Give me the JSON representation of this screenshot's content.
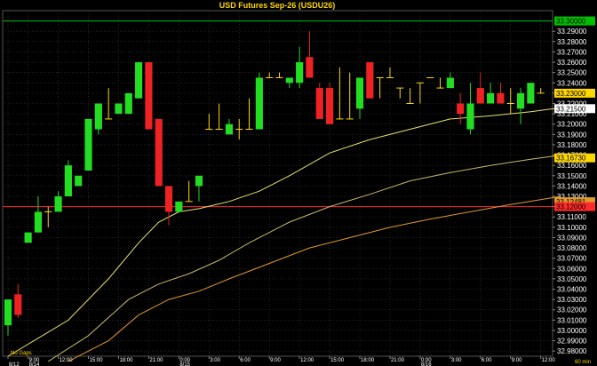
{
  "chart_data": {
    "type": "candlestick",
    "title": "USD  Futures  Sep-26  (USDU26)",
    "timeframe": "60  min",
    "note": "No  Gaps",
    "ylim": [
      32.975,
      33.31
    ],
    "y_ticks": [
      "33.29000",
      "33.28000",
      "33.27000",
      "33.26000",
      "33.25000",
      "33.24000",
      "33.23000",
      "33.22000",
      "33.21000",
      "33.20000",
      "33.19000",
      "33.18000",
      "33.17000",
      "33.16000",
      "33.15000",
      "33.14000",
      "33.13000",
      "33.12000",
      "33.11000",
      "33.10000",
      "33.09000",
      "33.08000",
      "33.07000",
      "33.06000",
      "33.05000",
      "33.04000",
      "33.03000",
      "33.02000",
      "33.01000",
      "33.00000",
      "32.99000",
      "32.98000"
    ],
    "y_tick_values": [
      33.29,
      33.28,
      33.27,
      33.26,
      33.25,
      33.24,
      33.23,
      33.22,
      33.21,
      33.2,
      33.19,
      33.18,
      33.17,
      33.16,
      33.15,
      33.14,
      33.13,
      33.12,
      33.11,
      33.1,
      33.09,
      33.08,
      33.07,
      33.06,
      33.05,
      33.04,
      33.03,
      33.02,
      33.01,
      33.0,
      32.99,
      32.98
    ],
    "x_ticks": [
      {
        "bar": 0,
        "top": "",
        "bottom": "8/12"
      },
      {
        "bar": 2,
        "top": "9:00",
        "bottom": "8/14"
      },
      {
        "bar": 5,
        "top": "12:00",
        "bottom": ""
      },
      {
        "bar": 8,
        "top": "15:00",
        "bottom": ""
      },
      {
        "bar": 11,
        "top": "18:00",
        "bottom": ""
      },
      {
        "bar": 14,
        "top": "21:00",
        "bottom": ""
      },
      {
        "bar": 17,
        "top": "0:00",
        "bottom": "8/15"
      },
      {
        "bar": 20,
        "top": "3:00",
        "bottom": ""
      },
      {
        "bar": 23,
        "top": "6:00",
        "bottom": ""
      },
      {
        "bar": 26,
        "top": "9:00",
        "bottom": ""
      },
      {
        "bar": 29,
        "top": "12:00",
        "bottom": ""
      },
      {
        "bar": 32,
        "top": "15:00",
        "bottom": ""
      },
      {
        "bar": 35,
        "top": "18:00",
        "bottom": ""
      },
      {
        "bar": 38,
        "top": "21:00",
        "bottom": ""
      },
      {
        "bar": 41,
        "top": "0:00",
        "bottom": "8/16"
      },
      {
        "bar": 44,
        "top": "3:00",
        "bottom": ""
      },
      {
        "bar": 47,
        "top": "6:00",
        "bottom": ""
      },
      {
        "bar": 50,
        "top": "9:00",
        "bottom": ""
      },
      {
        "bar": 53,
        "top": "12:00",
        "bottom": ""
      }
    ],
    "candles": [
      {
        "o": 33.005,
        "h": 33.03,
        "l": 32.995,
        "c": 33.03
      },
      {
        "o": 33.035,
        "h": 33.045,
        "l": 33.012,
        "c": 33.015
      },
      {
        "o": 33.085,
        "h": 33.095,
        "l": 33.085,
        "c": 33.095
      },
      {
        "o": 33.095,
        "h": 33.13,
        "l": 33.095,
        "c": 33.115
      },
      {
        "o": 33.115,
        "h": 33.12,
        "l": 33.1,
        "c": 33.115
      },
      {
        "o": 33.115,
        "h": 33.135,
        "l": 33.115,
        "c": 33.13
      },
      {
        "o": 33.13,
        "h": 33.165,
        "l": 33.13,
        "c": 33.16
      },
      {
        "o": 33.14,
        "h": 33.15,
        "l": 33.14,
        "c": 33.15
      },
      {
        "o": 33.155,
        "h": 33.205,
        "l": 33.155,
        "c": 33.205
      },
      {
        "o": 33.195,
        "h": 33.22,
        "l": 33.19,
        "c": 33.22
      },
      {
        "o": 33.205,
        "h": 33.235,
        "l": 33.205,
        "c": 33.205
      },
      {
        "o": 33.21,
        "h": 33.22,
        "l": 33.21,
        "c": 33.22
      },
      {
        "o": 33.21,
        "h": 33.23,
        "l": 33.21,
        "c": 33.23
      },
      {
        "o": 33.225,
        "h": 33.26,
        "l": 33.225,
        "c": 33.26
      },
      {
        "o": 33.26,
        "h": 33.26,
        "l": 33.195,
        "c": 33.195
      },
      {
        "o": 33.205,
        "h": 33.205,
        "l": 33.14,
        "c": 33.14
      },
      {
        "o": 33.14,
        "h": 33.14,
        "l": 33.102,
        "c": 33.115
      },
      {
        "o": 33.115,
        "h": 33.12,
        "l": 33.115,
        "c": 33.125
      },
      {
        "o": 33.125,
        "h": 33.145,
        "l": 33.125,
        "c": 33.125
      },
      {
        "o": 33.14,
        "h": 33.145,
        "l": 33.125,
        "c": 33.15
      },
      {
        "o": 33.195,
        "h": 33.21,
        "l": 33.195,
        "c": 33.195
      },
      {
        "o": 33.195,
        "h": 33.22,
        "l": 33.195,
        "c": 33.195
      },
      {
        "o": 33.19,
        "h": 33.205,
        "l": 33.19,
        "c": 33.2
      },
      {
        "o": 33.195,
        "h": 33.205,
        "l": 33.185,
        "c": 33.195
      },
      {
        "o": 33.195,
        "h": 33.225,
        "l": 33.195,
        "c": 33.195
      },
      {
        "o": 33.195,
        "h": 33.25,
        "l": 33.195,
        "c": 33.245
      },
      {
        "o": 33.245,
        "h": 33.25,
        "l": 33.245,
        "c": 33.245
      },
      {
        "o": 33.245,
        "h": 33.25,
        "l": 33.245,
        "c": 33.245
      },
      {
        "o": 33.24,
        "h": 33.245,
        "l": 33.235,
        "c": 33.245
      },
      {
        "o": 33.24,
        "h": 33.275,
        "l": 33.235,
        "c": 33.26
      },
      {
        "o": 33.265,
        "h": 33.29,
        "l": 33.245,
        "c": 33.245
      },
      {
        "o": 33.235,
        "h": 33.24,
        "l": 33.205,
        "c": 33.205
      },
      {
        "o": 33.235,
        "h": 33.24,
        "l": 33.2,
        "c": 33.2
      },
      {
        "o": 33.205,
        "h": 33.255,
        "l": 33.205,
        "c": 33.205
      },
      {
        "o": 33.205,
        "h": 33.25,
        "l": 33.205,
        "c": 33.205
      },
      {
        "o": 33.215,
        "h": 33.235,
        "l": 33.205,
        "c": 33.245
      },
      {
        "o": 33.26,
        "h": 33.26,
        "l": 33.225,
        "c": 33.225
      },
      {
        "o": 33.245,
        "h": 33.245,
        "l": 33.225,
        "c": 33.245
      },
      {
        "o": 33.245,
        "h": 33.255,
        "l": 33.245,
        "c": 33.245
      },
      {
        "o": 33.235,
        "h": 33.235,
        "l": 33.225,
        "c": 33.235
      },
      {
        "o": 33.22,
        "h": 33.235,
        "l": 33.22,
        "c": 33.22
      },
      {
        "o": 33.24,
        "h": 33.24,
        "l": 33.22,
        "c": 33.24
      },
      {
        "o": 33.245,
        "h": 33.245,
        "l": 33.245,
        "c": 33.245
      },
      {
        "o": 33.235,
        "h": 33.245,
        "l": 33.235,
        "c": 33.235
      },
      {
        "o": 33.235,
        "h": 33.25,
        "l": 33.235,
        "c": 33.245
      },
      {
        "o": 33.22,
        "h": 33.23,
        "l": 33.2,
        "c": 33.21
      },
      {
        "o": 33.195,
        "h": 33.24,
        "l": 33.19,
        "c": 33.22
      },
      {
        "o": 33.235,
        "h": 33.25,
        "l": 33.22,
        "c": 33.22
      },
      {
        "o": 33.22,
        "h": 33.24,
        "l": 33.22,
        "c": 33.23
      },
      {
        "o": 33.23,
        "h": 33.24,
        "l": 33.22,
        "c": 33.22
      },
      {
        "o": 33.22,
        "h": 33.235,
        "l": 33.21,
        "c": 33.22
      },
      {
        "o": 33.215,
        "h": 33.235,
        "l": 33.2,
        "c": 33.23
      },
      {
        "o": 33.22,
        "h": 33.24,
        "l": 33.22,
        "c": 33.24
      },
      {
        "o": 33.23,
        "h": 33.235,
        "l": 33.23,
        "c": 33.23
      }
    ],
    "moving_averages": [
      {
        "color": "#e8e26a",
        "points": [
          [
            0,
            32.975
          ],
          [
            6,
            33.01
          ],
          [
            10,
            33.05
          ],
          [
            13,
            33.085
          ],
          [
            15,
            33.105
          ],
          [
            17,
            33.115
          ],
          [
            19,
            33.118
          ],
          [
            22,
            33.125
          ],
          [
            25,
            33.135
          ],
          [
            28,
            33.15
          ],
          [
            32,
            33.172
          ],
          [
            36,
            33.185
          ],
          [
            40,
            33.195
          ],
          [
            44,
            33.205
          ],
          [
            48,
            33.208
          ],
          [
            52,
            33.212
          ],
          [
            55,
            33.216
          ]
        ]
      },
      {
        "color": "#c8b86a",
        "points": [
          [
            4,
            32.97
          ],
          [
            8,
            32.995
          ],
          [
            12,
            33.03
          ],
          [
            15,
            33.045
          ],
          [
            18,
            33.055
          ],
          [
            21,
            33.068
          ],
          [
            24,
            33.085
          ],
          [
            28,
            33.105
          ],
          [
            32,
            33.12
          ],
          [
            36,
            33.132
          ],
          [
            40,
            33.145
          ],
          [
            44,
            33.153
          ],
          [
            48,
            33.16
          ],
          [
            52,
            33.166
          ],
          [
            55,
            33.17
          ]
        ]
      },
      {
        "color": "#e09a2a",
        "points": [
          [
            6,
            32.97
          ],
          [
            10,
            32.99
          ],
          [
            13,
            33.015
          ],
          [
            16,
            33.03
          ],
          [
            19,
            33.038
          ],
          [
            22,
            33.05
          ],
          [
            26,
            33.065
          ],
          [
            30,
            33.08
          ],
          [
            34,
            33.09
          ],
          [
            38,
            33.1
          ],
          [
            42,
            33.108
          ],
          [
            46,
            33.115
          ],
          [
            50,
            33.122
          ],
          [
            55,
            33.13
          ]
        ]
      }
    ],
    "h_lines": [
      {
        "value": 33.3,
        "color": "#00c000"
      },
      {
        "value": 33.12,
        "color": "#ff2a2a"
      }
    ],
    "markers": [
      {
        "label": "33.30000",
        "value": 33.3,
        "bg": "#00c000",
        "fg": "#000000"
      },
      {
        "label": "33.23000",
        "value": 33.23,
        "bg": "#ffd800",
        "fg": "#000000"
      },
      {
        "label": "33.21500",
        "value": 33.215,
        "bg": "#ffffff",
        "fg": "#000000"
      },
      {
        "label": "33.16730",
        "value": 33.1673,
        "bg": "#ffd800",
        "fg": "#000000"
      },
      {
        "label": "33.12481",
        "value": 33.12481,
        "bg": "#e09a2a",
        "fg": "#000000"
      },
      {
        "label": "33.12000",
        "value": 33.12,
        "bg": "#ff2a2a",
        "fg": "#ffffff"
      }
    ],
    "colors": {
      "up": "#22dd22",
      "down": "#ee2222",
      "doji": "#ffd800",
      "grid": "#3a3a3a",
      "background": "#000000"
    }
  }
}
